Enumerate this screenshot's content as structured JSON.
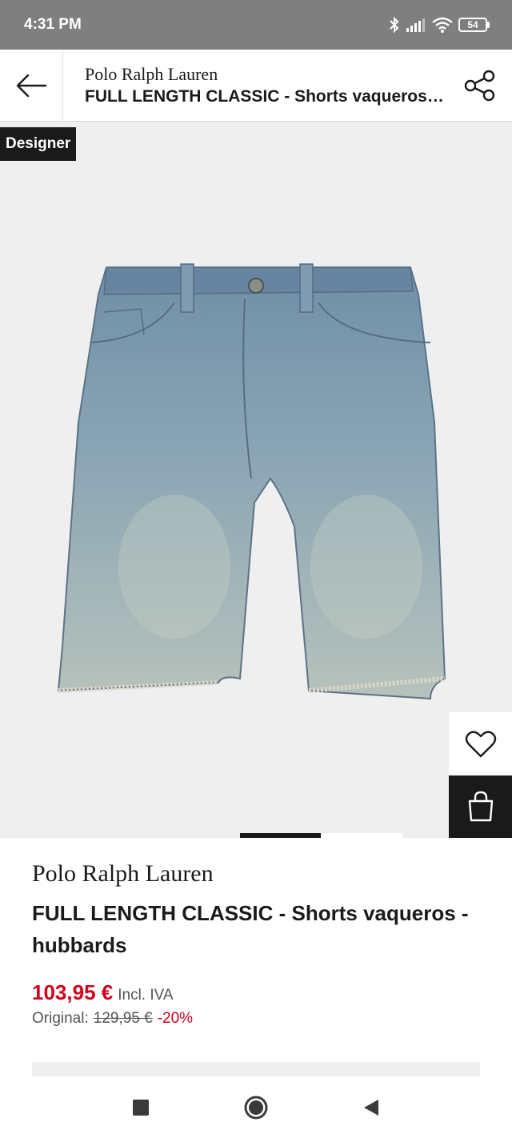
{
  "status_bar": {
    "time": "4:31 PM",
    "battery": "54",
    "icons": [
      "bluetooth-icon",
      "signal-icon",
      "wifi-icon",
      "battery-icon"
    ]
  },
  "header": {
    "back_icon": "arrow-left-icon",
    "brand": "Polo Ralph Lauren",
    "title": "FULL LENGTH CLASSIC - Shorts vaqueros - hubbards",
    "share_icon": "share-icon"
  },
  "hero": {
    "badge": "Designer",
    "image_name": "denim-shorts-image",
    "wishlist_icon": "heart-icon",
    "bag_icon": "shopping-bag-icon",
    "carousel": {
      "current": 1,
      "total": 2
    }
  },
  "product": {
    "brand": "Polo Ralph Lauren",
    "title": "FULL LENGTH CLASSIC - Shorts vaqueros - hubbards",
    "price": "103,95 €",
    "vat": "Incl. IVA",
    "original_label": "Original:",
    "original_price": "129,95 €",
    "discount": "-20%"
  },
  "nav_bar": {
    "icons": [
      "recents-square-icon",
      "home-circle-icon",
      "back-triangle-icon"
    ]
  },
  "colors": {
    "price_red": "#d0021b",
    "dark": "#1a1a1a",
    "status_gray": "#7f7f7f",
    "hero_bg": "#efeff0"
  }
}
